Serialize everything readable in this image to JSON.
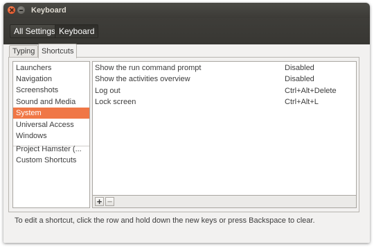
{
  "window": {
    "title": "Keyboard"
  },
  "toolbar": {
    "all_settings": "All Settings",
    "current": "Keyboard"
  },
  "tabs": [
    {
      "label": "Typing"
    },
    {
      "label": "Shortcuts"
    }
  ],
  "categories": [
    {
      "label": "Launchers"
    },
    {
      "label": "Navigation"
    },
    {
      "label": "Screenshots"
    },
    {
      "label": "Sound and Media"
    },
    {
      "label": "System"
    },
    {
      "label": "Universal Access"
    },
    {
      "label": "Windows"
    },
    {
      "label": "Project Hamster (..."
    },
    {
      "label": "Custom Shortcuts"
    }
  ],
  "selected_category": "System",
  "shortcuts": [
    {
      "action": "Show the run command prompt",
      "accel": "Disabled"
    },
    {
      "action": "Show the activities overview",
      "accel": "Disabled"
    },
    {
      "action": "Log out",
      "accel": "Ctrl+Alt+Delete"
    },
    {
      "action": "Lock screen",
      "accel": "Ctrl+Alt+L"
    }
  ],
  "edit_buttons": {
    "add": "+",
    "remove": "−"
  },
  "hint": "To edit a shortcut, click the row and hold down the new keys or press Backspace to clear.",
  "colors": {
    "selection": "#f07746",
    "titlebar": "#3c3b37"
  }
}
